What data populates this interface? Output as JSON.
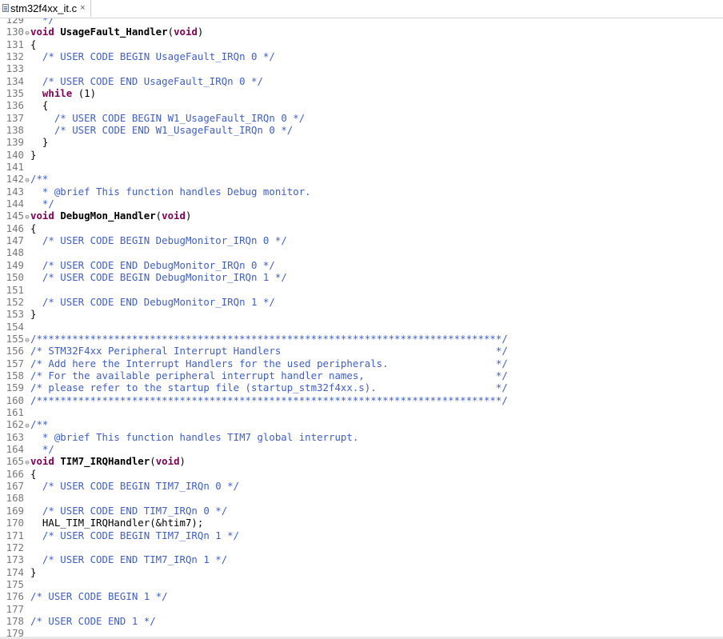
{
  "tab": {
    "title": "stm32f4xx_it.c",
    "close": "×"
  },
  "lines": [
    {
      "num": "129",
      "fold": "",
      "tokens": [
        {
          "t": "cmt",
          "s": "  */"
        }
      ]
    },
    {
      "num": "130",
      "fold": "⊖",
      "tokens": [
        {
          "t": "kw",
          "s": "void"
        },
        {
          "t": "plain",
          "s": " "
        },
        {
          "t": "fn",
          "s": "UsageFault_Handler"
        },
        {
          "t": "plain",
          "s": "("
        },
        {
          "t": "kw",
          "s": "void"
        },
        {
          "t": "plain",
          "s": ")"
        }
      ]
    },
    {
      "num": "131",
      "fold": "",
      "tokens": [
        {
          "t": "plain",
          "s": "{"
        }
      ]
    },
    {
      "num": "132",
      "fold": "",
      "tokens": [
        {
          "t": "plain",
          "s": "  "
        },
        {
          "t": "cmt",
          "s": "/* USER CODE BEGIN UsageFault_IRQn 0 */"
        }
      ]
    },
    {
      "num": "133",
      "fold": "",
      "tokens": []
    },
    {
      "num": "134",
      "fold": "",
      "tokens": [
        {
          "t": "plain",
          "s": "  "
        },
        {
          "t": "cmt",
          "s": "/* USER CODE END UsageFault_IRQn 0 */"
        }
      ]
    },
    {
      "num": "135",
      "fold": "",
      "tokens": [
        {
          "t": "plain",
          "s": "  "
        },
        {
          "t": "kw",
          "s": "while"
        },
        {
          "t": "plain",
          "s": " (1)"
        }
      ]
    },
    {
      "num": "136",
      "fold": "",
      "tokens": [
        {
          "t": "plain",
          "s": "  {"
        }
      ]
    },
    {
      "num": "137",
      "fold": "",
      "tokens": [
        {
          "t": "plain",
          "s": "    "
        },
        {
          "t": "cmt",
          "s": "/* USER CODE BEGIN W1_UsageFault_IRQn 0 */"
        }
      ]
    },
    {
      "num": "138",
      "fold": "",
      "tokens": [
        {
          "t": "plain",
          "s": "    "
        },
        {
          "t": "cmt",
          "s": "/* USER CODE END W1_UsageFault_IRQn 0 */"
        }
      ]
    },
    {
      "num": "139",
      "fold": "",
      "tokens": [
        {
          "t": "plain",
          "s": "  }"
        }
      ]
    },
    {
      "num": "140",
      "fold": "",
      "tokens": [
        {
          "t": "plain",
          "s": "}"
        }
      ]
    },
    {
      "num": "141",
      "fold": "",
      "tokens": []
    },
    {
      "num": "142",
      "fold": "⊖",
      "tokens": [
        {
          "t": "cmt",
          "s": "/**"
        }
      ]
    },
    {
      "num": "143",
      "fold": "",
      "tokens": [
        {
          "t": "cmt",
          "s": "  * @brief This function handles Debug monitor."
        }
      ]
    },
    {
      "num": "144",
      "fold": "",
      "tokens": [
        {
          "t": "cmt",
          "s": "  */"
        }
      ]
    },
    {
      "num": "145",
      "fold": "⊖",
      "tokens": [
        {
          "t": "kw",
          "s": "void"
        },
        {
          "t": "plain",
          "s": " "
        },
        {
          "t": "fn",
          "s": "DebugMon_Handler"
        },
        {
          "t": "plain",
          "s": "("
        },
        {
          "t": "kw",
          "s": "void"
        },
        {
          "t": "plain",
          "s": ")"
        }
      ]
    },
    {
      "num": "146",
      "fold": "",
      "tokens": [
        {
          "t": "plain",
          "s": "{"
        }
      ]
    },
    {
      "num": "147",
      "fold": "",
      "tokens": [
        {
          "t": "plain",
          "s": "  "
        },
        {
          "t": "cmt",
          "s": "/* USER CODE BEGIN DebugMonitor_IRQn 0 */"
        }
      ]
    },
    {
      "num": "148",
      "fold": "",
      "tokens": []
    },
    {
      "num": "149",
      "fold": "",
      "tokens": [
        {
          "t": "plain",
          "s": "  "
        },
        {
          "t": "cmt",
          "s": "/* USER CODE END DebugMonitor_IRQn 0 */"
        }
      ]
    },
    {
      "num": "150",
      "fold": "",
      "tokens": [
        {
          "t": "plain",
          "s": "  "
        },
        {
          "t": "cmt",
          "s": "/* USER CODE BEGIN DebugMonitor_IRQn 1 */"
        }
      ]
    },
    {
      "num": "151",
      "fold": "",
      "tokens": []
    },
    {
      "num": "152",
      "fold": "",
      "tokens": [
        {
          "t": "plain",
          "s": "  "
        },
        {
          "t": "cmt",
          "s": "/* USER CODE END DebugMonitor_IRQn 1 */"
        }
      ]
    },
    {
      "num": "153",
      "fold": "",
      "tokens": [
        {
          "t": "plain",
          "s": "}"
        }
      ]
    },
    {
      "num": "154",
      "fold": "",
      "tokens": []
    },
    {
      "num": "155",
      "fold": "⊖",
      "tokens": [
        {
          "t": "cmt",
          "s": "/******************************************************************************/"
        }
      ]
    },
    {
      "num": "156",
      "fold": "",
      "tokens": [
        {
          "t": "cmt",
          "s": "/* STM32F4xx Peripheral Interrupt Handlers                                    */"
        }
      ]
    },
    {
      "num": "157",
      "fold": "",
      "tokens": [
        {
          "t": "cmt",
          "s": "/* Add here the Interrupt Handlers for the used peripherals.                  */"
        }
      ]
    },
    {
      "num": "158",
      "fold": "",
      "tokens": [
        {
          "t": "cmt",
          "s": "/* For the available peripheral interrupt handler names,                      */"
        }
      ]
    },
    {
      "num": "159",
      "fold": "",
      "tokens": [
        {
          "t": "cmt",
          "s": "/* please refer to the startup file (startup_stm32f4xx.s).                    */"
        }
      ]
    },
    {
      "num": "160",
      "fold": "",
      "tokens": [
        {
          "t": "cmt",
          "s": "/******************************************************************************/"
        }
      ]
    },
    {
      "num": "161",
      "fold": "",
      "tokens": []
    },
    {
      "num": "162",
      "fold": "⊖",
      "tokens": [
        {
          "t": "cmt",
          "s": "/**"
        }
      ]
    },
    {
      "num": "163",
      "fold": "",
      "tokens": [
        {
          "t": "cmt",
          "s": "  * @brief This function handles TIM7 global interrupt."
        }
      ]
    },
    {
      "num": "164",
      "fold": "",
      "tokens": [
        {
          "t": "cmt",
          "s": "  */"
        }
      ]
    },
    {
      "num": "165",
      "fold": "⊖",
      "tokens": [
        {
          "t": "kw",
          "s": "void"
        },
        {
          "t": "plain",
          "s": " "
        },
        {
          "t": "fn",
          "s": "TIM7_IRQHandler"
        },
        {
          "t": "plain",
          "s": "("
        },
        {
          "t": "kw",
          "s": "void"
        },
        {
          "t": "plain",
          "s": ")"
        }
      ]
    },
    {
      "num": "166",
      "fold": "",
      "tokens": [
        {
          "t": "plain",
          "s": "{"
        }
      ]
    },
    {
      "num": "167",
      "fold": "",
      "tokens": [
        {
          "t": "plain",
          "s": "  "
        },
        {
          "t": "cmt",
          "s": "/* USER CODE BEGIN TIM7_IRQn 0 */"
        }
      ]
    },
    {
      "num": "168",
      "fold": "",
      "tokens": []
    },
    {
      "num": "169",
      "fold": "",
      "tokens": [
        {
          "t": "plain",
          "s": "  "
        },
        {
          "t": "cmt",
          "s": "/* USER CODE END TIM7_IRQn 0 */"
        }
      ]
    },
    {
      "num": "170",
      "fold": "",
      "tokens": [
        {
          "t": "plain",
          "s": "  HAL_TIM_IRQHandler(&htim7);"
        }
      ]
    },
    {
      "num": "171",
      "fold": "",
      "tokens": [
        {
          "t": "plain",
          "s": "  "
        },
        {
          "t": "cmt",
          "s": "/* USER CODE BEGIN TIM7_IRQn 1 */"
        }
      ]
    },
    {
      "num": "172",
      "fold": "",
      "tokens": []
    },
    {
      "num": "173",
      "fold": "",
      "tokens": [
        {
          "t": "plain",
          "s": "  "
        },
        {
          "t": "cmt",
          "s": "/* USER CODE END TIM7_IRQn 1 */"
        }
      ]
    },
    {
      "num": "174",
      "fold": "",
      "tokens": [
        {
          "t": "plain",
          "s": "}"
        }
      ]
    },
    {
      "num": "175",
      "fold": "",
      "tokens": []
    },
    {
      "num": "176",
      "fold": "",
      "tokens": [
        {
          "t": "cmt",
          "s": "/* USER CODE BEGIN 1 */"
        }
      ]
    },
    {
      "num": "177",
      "fold": "",
      "tokens": []
    },
    {
      "num": "178",
      "fold": "",
      "tokens": [
        {
          "t": "cmt",
          "s": "/* USER CODE END 1 */"
        }
      ]
    },
    {
      "num": "179",
      "fold": "",
      "tokens": []
    }
  ]
}
